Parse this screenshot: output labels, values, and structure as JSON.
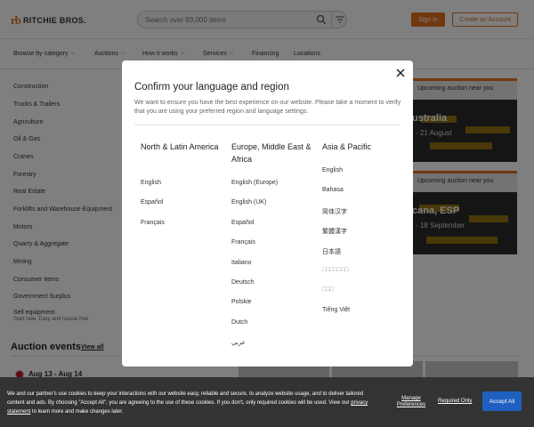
{
  "header": {
    "logo_mark": "rb",
    "logo_text": "RITCHIE BROS.",
    "search_placeholder": "Search over 93,000 items",
    "signin_label": "Sign in",
    "create_account_label": "Create an Account"
  },
  "nav": {
    "items": [
      {
        "label": "Browse by category",
        "has_chevron": true
      },
      {
        "label": "Auctions",
        "has_chevron": true
      },
      {
        "label": "How it works",
        "has_chevron": true
      },
      {
        "label": "Services",
        "has_chevron": true
      },
      {
        "label": "Financing",
        "has_chevron": false
      },
      {
        "label": "Locations",
        "has_chevron": false
      }
    ]
  },
  "categories": [
    "Construction",
    "Trucks & Trailers",
    "Agriculture",
    "Oil & Gas",
    "Cranes",
    "Forestry",
    "Real Estate",
    "Forklifts and Warehouse Equipment",
    "Motors",
    "Quarry & Aggregate",
    "Mining",
    "Consumer Items",
    "Government Surplus"
  ],
  "sell": {
    "title": "Sell equipment",
    "subtitle": "Start now. Easy and hassle free"
  },
  "upcoming": [
    {
      "label": "Upcoming auction near you",
      "title": "ustralia",
      "dates": "- 21 August"
    },
    {
      "label": "Upcoming auction near you",
      "title": "cana, ESP",
      "dates": "- 18 September"
    }
  ],
  "events": {
    "title": "Auction events",
    "view_all": "View all",
    "first_date": "Aug 13 - Aug 14"
  },
  "modal": {
    "title": "Confirm your language and region",
    "description": "We want to ensure you have the best experience on our website. Please take a moment to verify that you are using your preferred region and language settings.",
    "regions": [
      {
        "heading": "North & Latin America",
        "languages": [
          "English",
          "Español",
          "Français"
        ]
      },
      {
        "heading": "Europe, Middle East & Africa",
        "languages": [
          "English (Europe)",
          "English (UK)",
          "Español",
          "Français",
          "Italiano",
          "Deutsch",
          "Polskie",
          "Dutch",
          "عربي"
        ]
      },
      {
        "heading": "Asia & Pacific",
        "languages": [
          "English",
          "Bahasa",
          "简体汉字",
          "繁體漢字",
          "日本語",
          "□□□□□□□",
          "□□□",
          "Tiếng Việt"
        ]
      }
    ]
  },
  "cookie": {
    "text_before_link": "We and our partner's use cookies to keep your interactions with our website easy, reliable and secure, to analyze website usage, and to deliver tailored content and ads. By choosing \"Accept All\", you are agreeing to the use of these cookies. If you don't, only required cookies will be used. View our",
    "link_text": "privacy statement",
    "text_after_link": "to learn more and make changes later.",
    "manage_label": "Manage Preferences",
    "required_label": "Required Only",
    "accept_label": "Accept All"
  },
  "colors": {
    "brand_orange": "#e0701f",
    "accept_blue": "#1f5fbf",
    "cookie_bg": "#333333"
  }
}
